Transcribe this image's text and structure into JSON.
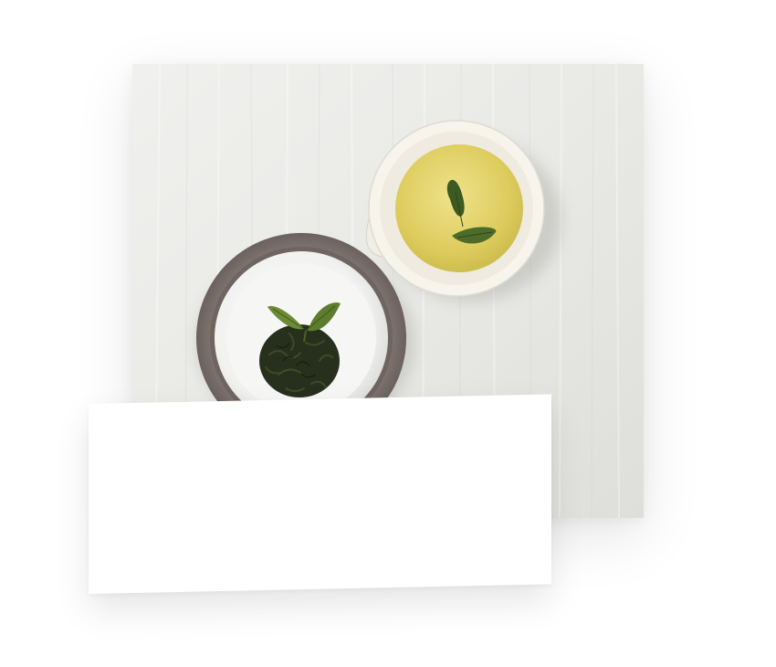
{
  "scene": {
    "subject": "green-tea-flatlay",
    "colors": {
      "tablecloth": "#ececea",
      "tea": "#e3d36a",
      "leaf_dark": "#2f3b22",
      "leaf_fresh": "#5c7a2e",
      "cup": "#f6f3ea",
      "saucer_rim": "#7d726d"
    }
  }
}
